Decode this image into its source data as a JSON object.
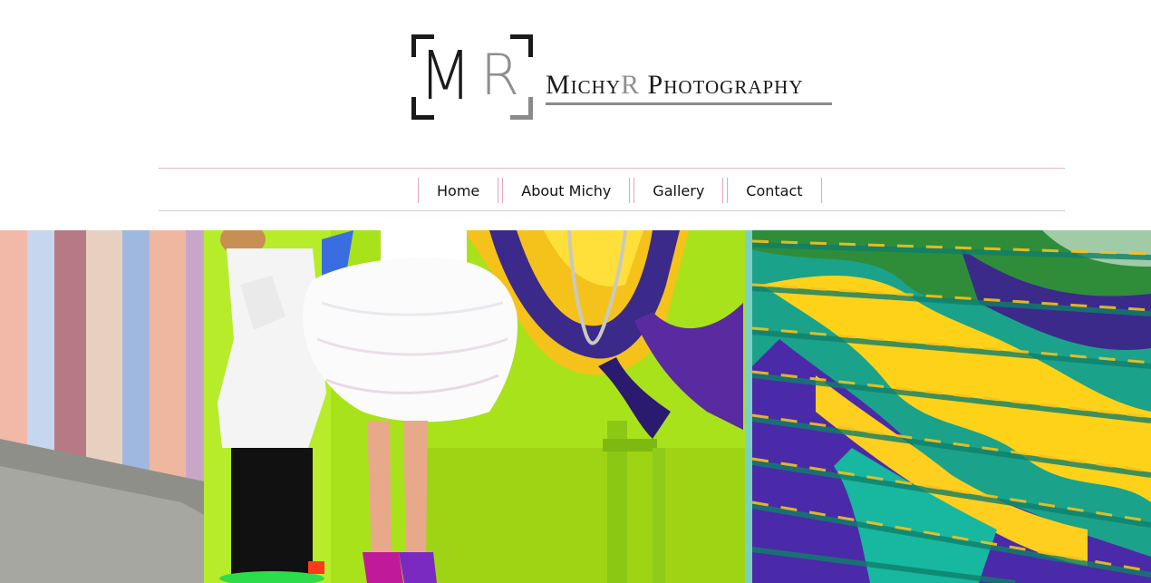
{
  "brand": {
    "part1": "Michy",
    "part2": "R",
    "part3": " Photography",
    "mark_m": "M",
    "mark_r": "R"
  },
  "nav": {
    "items": [
      {
        "label": "Home"
      },
      {
        "label": "About Michy"
      },
      {
        "label": "Gallery"
      },
      {
        "label": "Contact"
      }
    ]
  },
  "colors": {
    "nav_border": "#e2b9c4",
    "lime": "#a8e21a",
    "purple": "#3b2a8a",
    "yellow": "#ffd21a",
    "teal": "#1aa38a"
  }
}
